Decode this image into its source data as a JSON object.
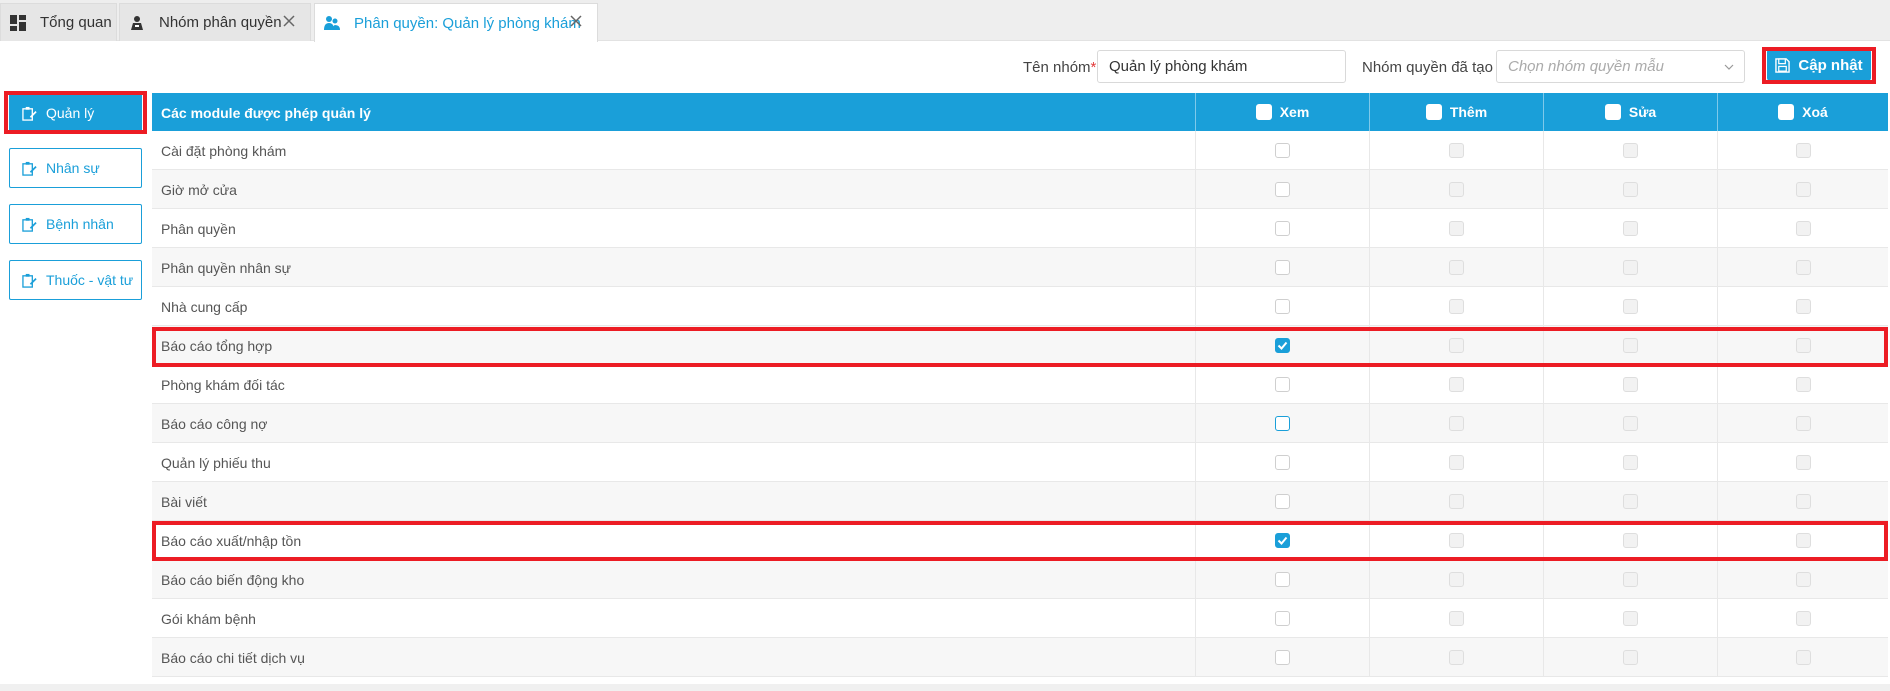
{
  "tabs": [
    {
      "label": "Tổng quan",
      "icon": "dashboard-icon"
    },
    {
      "label": "Nhóm phân quyền",
      "icon": "group-icon"
    },
    {
      "label": "Phân quyền: Quản lý phòng khám",
      "icon": "users-icon"
    }
  ],
  "form": {
    "group_name_label": "Tên nhóm",
    "required_mark": "*",
    "group_name_value": "Quản lý phòng khám",
    "template_label": "Nhóm quyền đã tạo :",
    "template_placeholder": "Chọn nhóm quyền mẫu",
    "update_label": "Cập nhật"
  },
  "sidebar": [
    {
      "label": "Quản lý",
      "active": true
    },
    {
      "label": "Nhân sự",
      "active": false
    },
    {
      "label": "Bệnh nhân",
      "active": false
    },
    {
      "label": "Thuốc - vật tư",
      "active": false
    }
  ],
  "table": {
    "header_module": "Các module được phép quản lý",
    "header_view": "Xem",
    "header_add": "Thêm",
    "header_edit": "Sửa",
    "header_delete": "Xoá",
    "rows": [
      {
        "name": "Cài đặt phòng khám",
        "view": "unchecked"
      },
      {
        "name": "Giờ mở cửa",
        "view": "unchecked"
      },
      {
        "name": "Phân quyền",
        "view": "unchecked"
      },
      {
        "name": "Phân quyền nhân sự",
        "view": "unchecked"
      },
      {
        "name": "Nhà cung cấp",
        "view": "unchecked"
      },
      {
        "name": "Báo cáo tổng hợp",
        "view": "checked"
      },
      {
        "name": "Phòng khám đối tác",
        "view": "unchecked"
      },
      {
        "name": "Báo cáo công nợ",
        "view": "focus"
      },
      {
        "name": "Quản lý phiếu thu",
        "view": "unchecked"
      },
      {
        "name": "Bài viết",
        "view": "unchecked"
      },
      {
        "name": "Báo cáo xuất/nhập tồn",
        "view": "checked"
      },
      {
        "name": "Báo cáo biến động kho",
        "view": "unchecked"
      },
      {
        "name": "Gói khám bệnh",
        "view": "unchecked"
      },
      {
        "name": "Báo cáo chi tiết dịch vụ",
        "view": "unchecked"
      }
    ]
  },
  "colors": {
    "accent": "#1a9fd9",
    "highlight": "#ec1c24"
  }
}
